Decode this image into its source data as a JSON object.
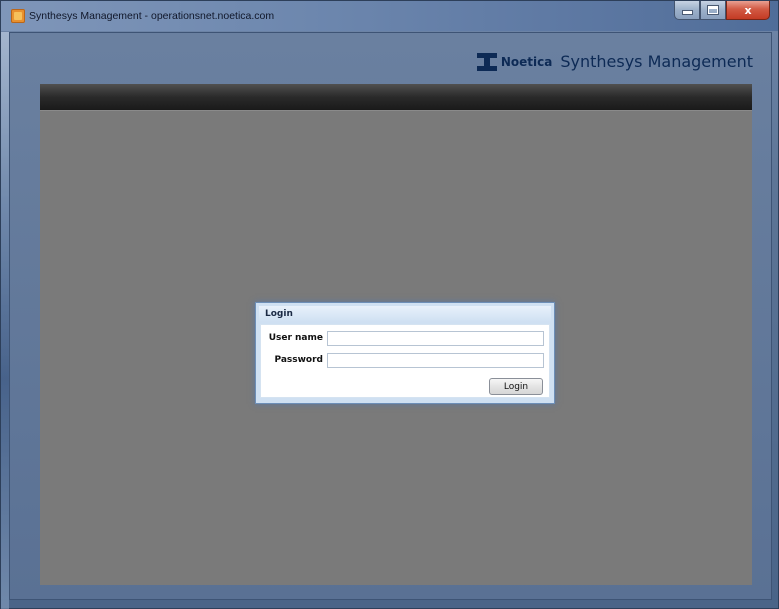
{
  "window": {
    "title": "Synthesys Management - operationsnet.noetica.com",
    "controls": {
      "minimize_icon": "minimize-icon",
      "maximize_icon": "maximize-icon",
      "close_label": "x"
    }
  },
  "brand": {
    "company": "Noetica",
    "product": "Synthesys Management",
    "logo_icon": "noetica-logo"
  },
  "login_dialog": {
    "title": "Login",
    "username_label": "User name",
    "username_value": "",
    "password_label": "Password",
    "password_value": "",
    "submit_label": "Login"
  },
  "colors": {
    "brand": "#0d2a55",
    "topbar": "#2a2a2a",
    "workspace": "#7a7a7a",
    "dialog_border": "#6d8fb8"
  }
}
